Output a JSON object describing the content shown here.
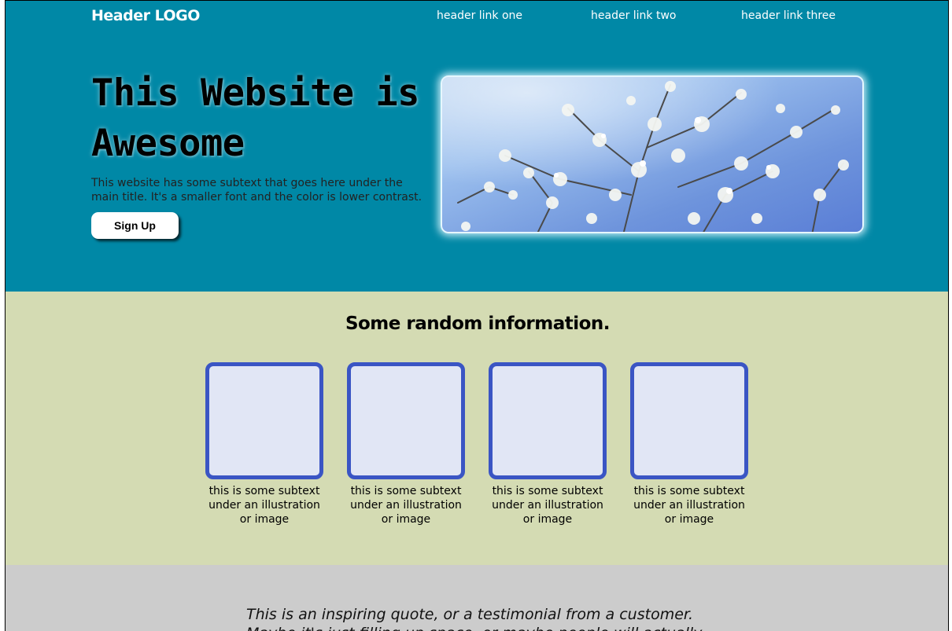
{
  "header": {
    "logo": "Header LOGO",
    "links": [
      "header link one",
      "header link two",
      "header link three"
    ]
  },
  "hero": {
    "title": "This Website is Awesome",
    "subtext": "This website has some subtext that goes here under the main title. It's a smaller font and the color is lower contrast.",
    "button_label": "Sign Up",
    "image_subject": "white blossom branches against blue sky"
  },
  "info": {
    "heading": "Some random information.",
    "cards": [
      {
        "caption": "this is some subtext under an illustration or image"
      },
      {
        "caption": "this is some subtext under an illustration or image"
      },
      {
        "caption": "this is some subtext under an illustration or image"
      },
      {
        "caption": "this is some subtext under an illustration or image"
      }
    ]
  },
  "quote": {
    "text": "This is an inspiring quote, or a testimonial from a customer. Maybe it's just filling up space, or maybe people will actually read it. Who"
  },
  "colors": {
    "hero_bg": "#0088a6",
    "info_bg": "#d4dbb3",
    "card_border": "#3a55c4",
    "card_fill": "#e1e6f5",
    "quote_bg": "#cccccc"
  }
}
